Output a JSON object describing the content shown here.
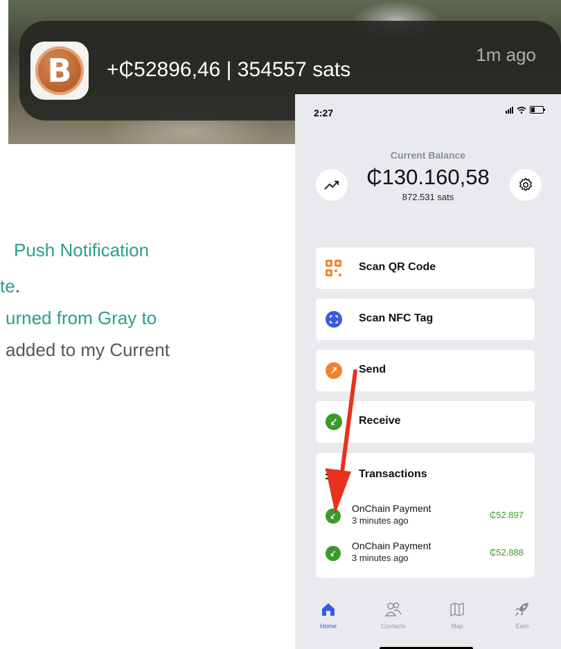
{
  "notification": {
    "title": "+₵52896,46 | 354557 sats",
    "time": "1m ago",
    "app_icon": "bitcoin-app-icon"
  },
  "annotation": {
    "line1": "Push Notification",
    "line2_text": "te",
    "line2_dot": ".",
    "line3": "urned from Gray to",
    "line4": "added to my Current"
  },
  "phone": {
    "status": {
      "time": "2:27"
    },
    "balance": {
      "label": "Current Balance",
      "amount": "₵130.160,58",
      "sats": "872.531 sats"
    },
    "actions": [
      {
        "label": "Scan QR Code",
        "icon": "qr-code-icon"
      },
      {
        "label": "Scan NFC Tag",
        "icon": "nfc-icon"
      },
      {
        "label": "Send",
        "icon": "send-arrow-icon"
      },
      {
        "label": "Receive",
        "icon": "receive-arrow-icon"
      }
    ],
    "transactions": {
      "title": "Transactions",
      "items": [
        {
          "name": "OnChain Payment",
          "time": "3 minutes ago",
          "amount": "₵52.897"
        },
        {
          "name": "OnChain Payment",
          "time": "3 minutes ago",
          "amount": "₵52.888"
        }
      ]
    },
    "tabs": [
      {
        "label": "Home",
        "icon": "home-icon",
        "active": true
      },
      {
        "label": "Contacts",
        "icon": "contacts-icon"
      },
      {
        "label": "Map",
        "icon": "map-icon"
      },
      {
        "label": "Earn",
        "icon": "rocket-icon"
      }
    ]
  },
  "colors": {
    "accent": "#2a9d8f",
    "green": "#3c9a26",
    "orange": "#f5822a",
    "blue": "#3a5be0",
    "arrow": "#e8321e"
  }
}
